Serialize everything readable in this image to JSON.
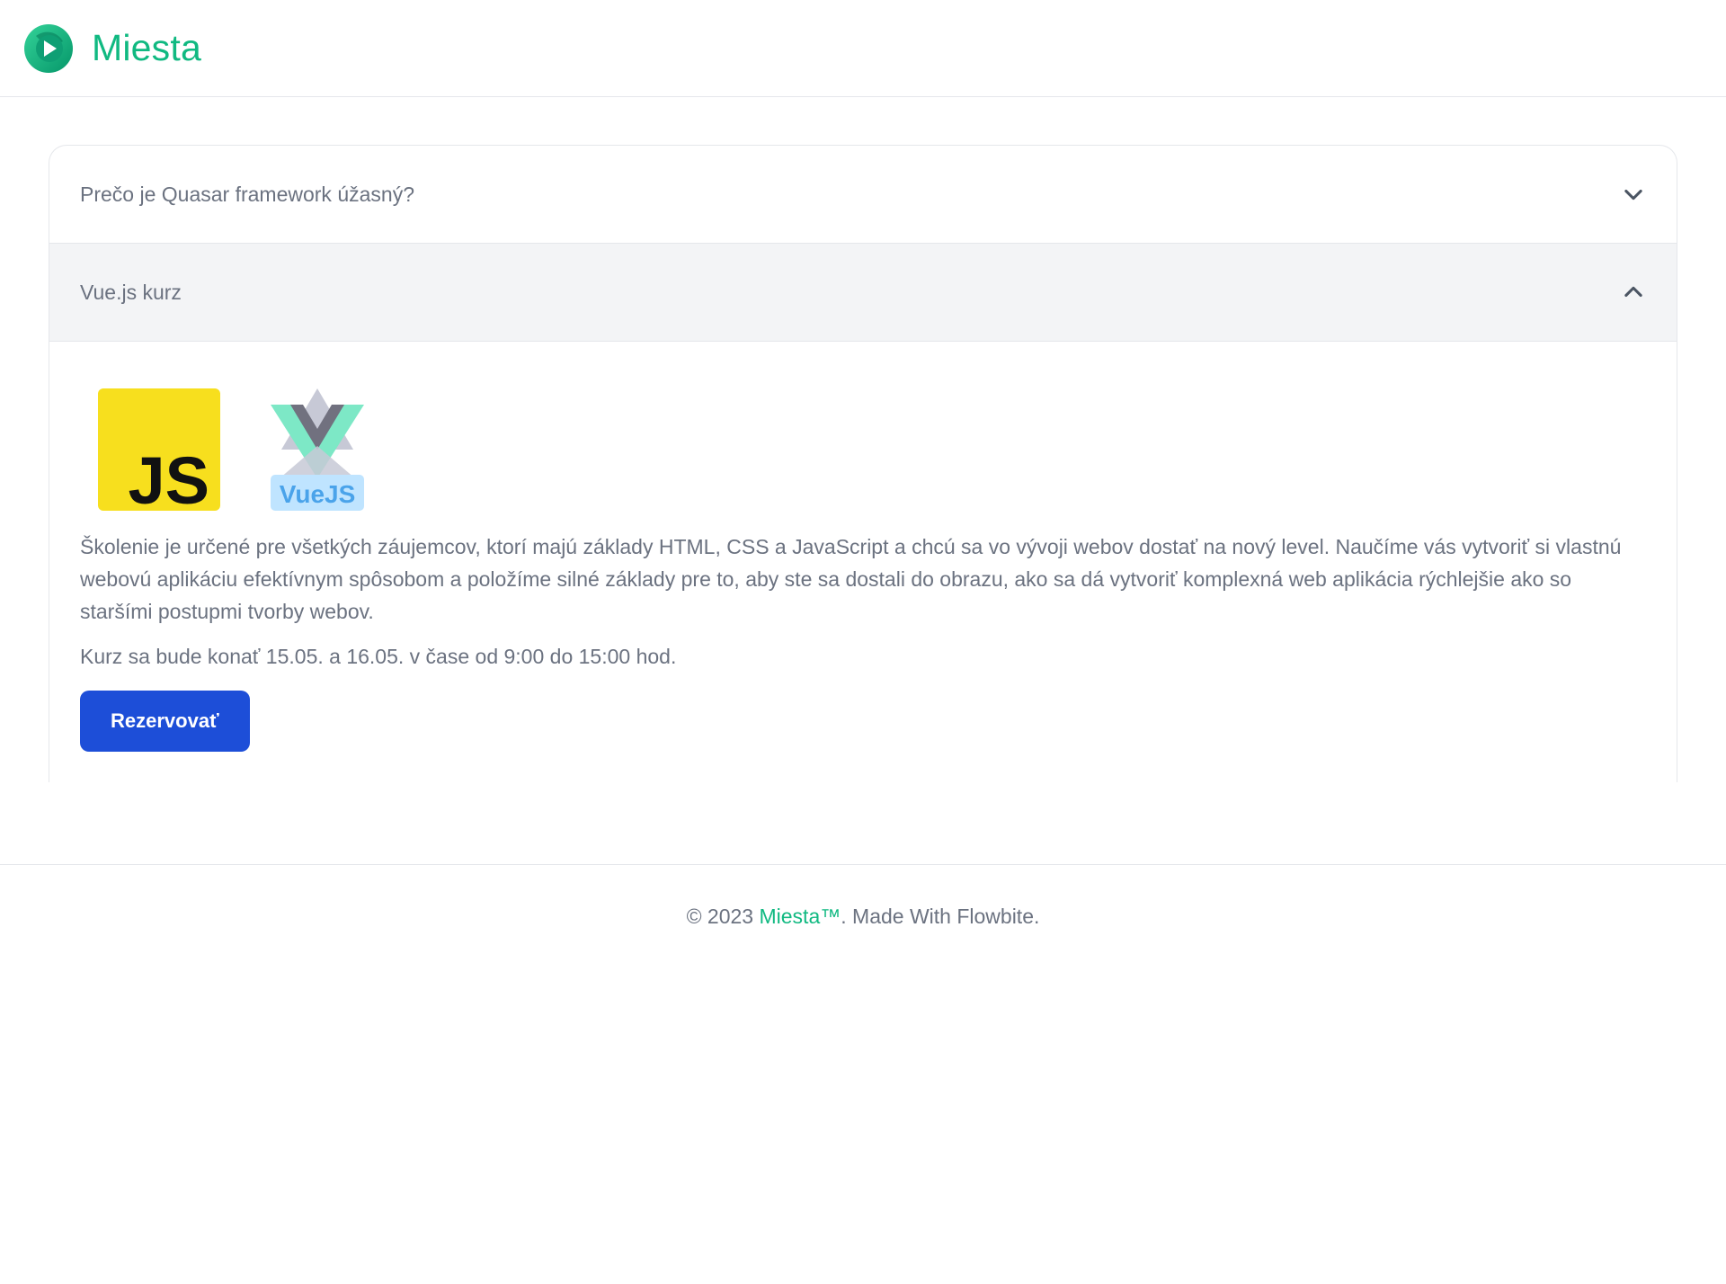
{
  "header": {
    "brand": "Miesta",
    "logo_icon": "play-circle-icon"
  },
  "colors": {
    "brand": "#10b981",
    "primary_button": "#1d4ed8",
    "active_header_bg": "#f3f4f6"
  },
  "accordion": {
    "items": [
      {
        "title": "Prečo je Quasar framework úžasný?",
        "expanded": false,
        "icon": "chevron-down-icon"
      },
      {
        "title": "Vue.js kurz",
        "expanded": true,
        "icon": "chevron-up-icon"
      }
    ],
    "body": {
      "logos": [
        "javascript-logo",
        "vuejs-logo"
      ],
      "js_logo_text": "JS",
      "vue_logo_text": "VueJS",
      "description": "Školenie je určené pre všetkých záujemcov, ktorí majú základy HTML, CSS a JavaScript a chcú sa vo vývoji webov dostať na nový level. Naučíme vás vytvoriť si vlastnú webovú aplikáciu efektívnym spôsobom a položíme silné základy pre to, aby ste sa dostali do obrazu, ako sa dá vytvoriť komplexná web aplikácia rýchlejšie ako so staršími postupmi tvorby webov.",
      "schedule": "Kurz sa bude konať 15.05. a 16.05. v čase od 9:00 do 15:00 hod.",
      "button_label": "Rezervovať"
    }
  },
  "footer": {
    "prefix": "© 2023 ",
    "brand": "Miesta™",
    "suffix": ". Made With Flowbite."
  }
}
